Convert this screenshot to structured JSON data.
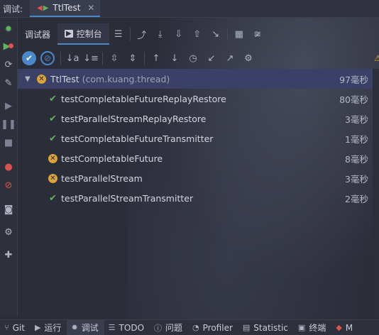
{
  "titlebar": {
    "label": "调试:",
    "run_tab": "TtlTest",
    "close_glyph": "✕"
  },
  "toolbar1": {
    "tab_debugger": "调试器",
    "tab_console": "控制台"
  },
  "tree": {
    "root": {
      "name": "TtlTest",
      "package": " (com.kuang.thread)",
      "time": "97毫秒",
      "status": "failed"
    },
    "items": [
      {
        "name": "testCompletableFutureReplayRestore",
        "time": "80毫秒",
        "status": "passed"
      },
      {
        "name": "testParallelStreamReplayRestore",
        "time": "3毫秒",
        "status": "passed"
      },
      {
        "name": "testCompletableFutureTransmitter",
        "time": "1毫秒",
        "status": "passed"
      },
      {
        "name": "testCompletableFuture",
        "time": "8毫秒",
        "status": "failed"
      },
      {
        "name": "testParallelStream",
        "time": "3毫秒",
        "status": "failed"
      },
      {
        "name": "testParallelStreamTransmitter",
        "time": "2毫秒",
        "status": "passed"
      }
    ]
  },
  "bottombar": {
    "git": "Git",
    "run": "运行",
    "debug": "调试",
    "todo": "TODO",
    "problems": "问题",
    "profiler": "Profiler",
    "statistic": "Statistic",
    "terminal": "终端",
    "more": "M"
  },
  "colors": {
    "accent": "#4a88c7",
    "passed": "#5fb35f",
    "failed": "#d9a53c",
    "selected_row": "#3b4066"
  }
}
